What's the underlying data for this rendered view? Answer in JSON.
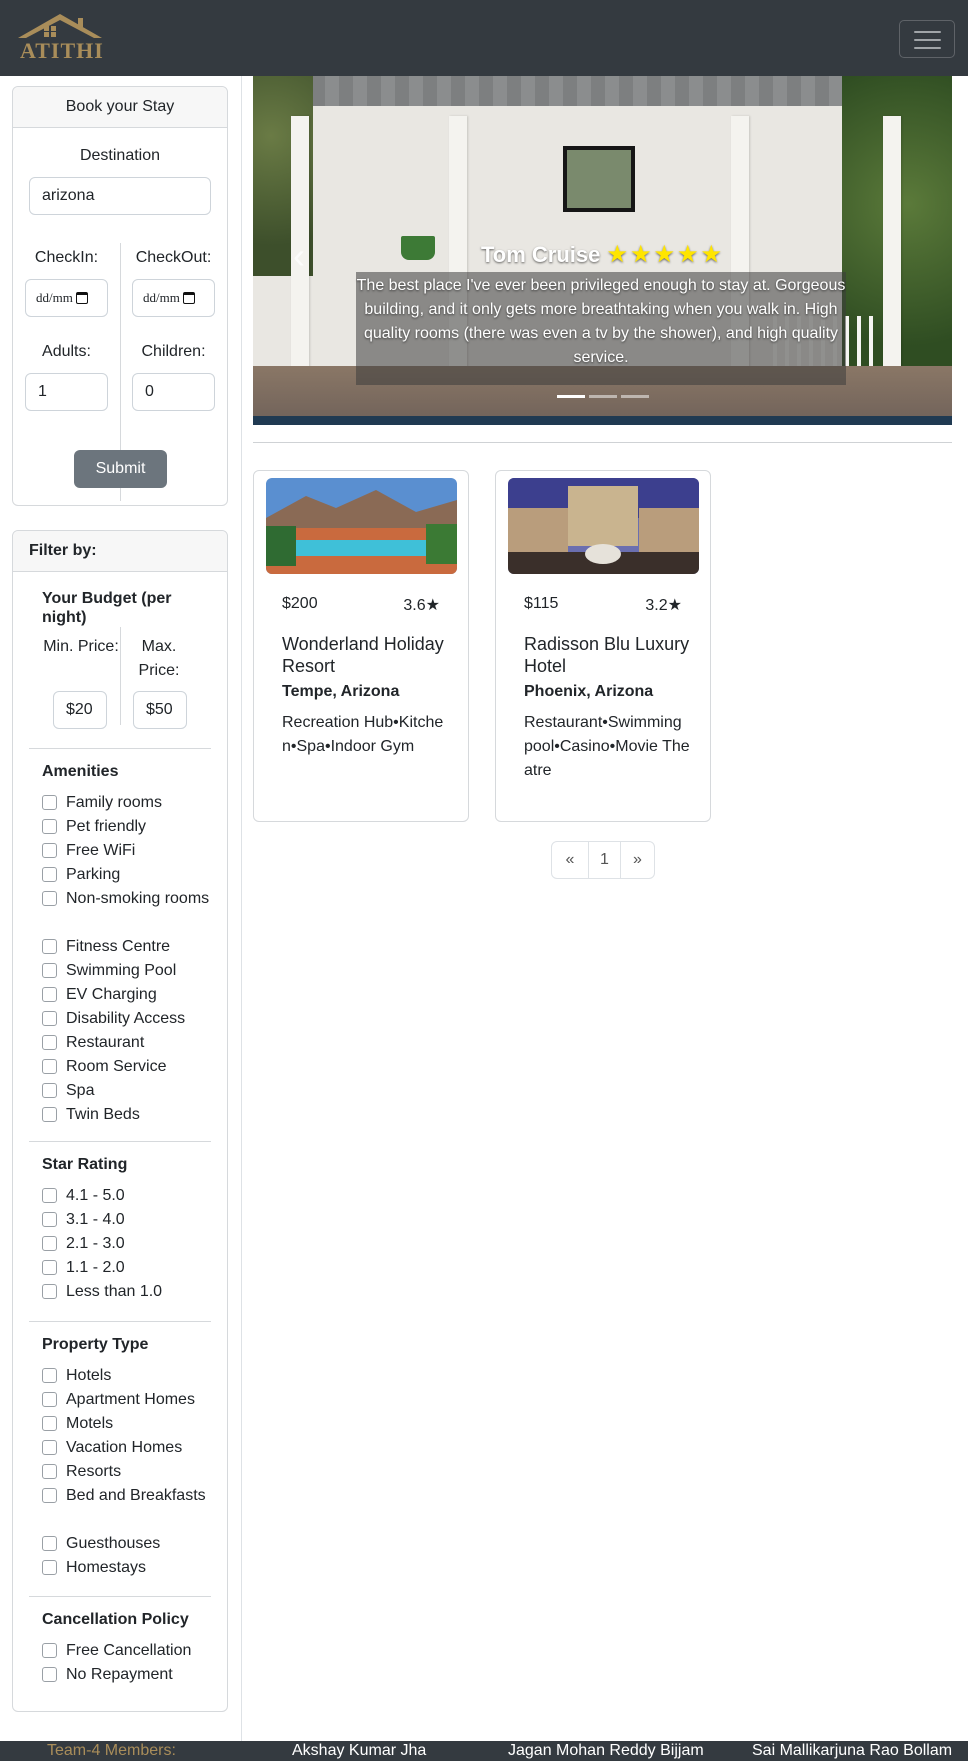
{
  "brand": {
    "name": "ATITHI"
  },
  "booking": {
    "title": "Book your Stay",
    "destination_label": "Destination",
    "destination_value": "arizona",
    "checkin_label": "CheckIn:",
    "checkout_label": "CheckOut:",
    "date_placeholder": "dd/mm",
    "adults_label": "Adults:",
    "adults_value": "1",
    "children_label": "Children:",
    "children_value": "0",
    "submit_label": "Submit"
  },
  "filters": {
    "title": "Filter by:",
    "budget": {
      "title": "Your Budget (per night)",
      "min_label": "Min. Price:",
      "max_label": "Max. Price:",
      "min_value": "$20",
      "max_value": "$50"
    },
    "amenities": {
      "title": "Amenities",
      "items": [
        "Family rooms",
        "Pet friendly",
        "Free WiFi",
        "Parking",
        "Non-smoking rooms",
        "Fitness Centre",
        "Swimming Pool",
        "EV Charging",
        "Disability Access",
        "Restaurant",
        "Room Service",
        "Spa",
        "Twin Beds"
      ]
    },
    "star_rating": {
      "title": "Star Rating",
      "items": [
        "4.1 - 5.0",
        "3.1 - 4.0",
        "2.1 - 3.0",
        "1.1 - 2.0",
        "Less than 1.0"
      ]
    },
    "property_type": {
      "title": "Property Type",
      "items": [
        "Hotels",
        "Apartment Homes",
        "Motels",
        "Vacation Homes",
        "Resorts",
        "Bed and Breakfasts",
        "Guesthouses",
        "Homestays"
      ]
    },
    "cancellation": {
      "title": "Cancellation Policy",
      "items": [
        "Free Cancellation",
        "No Repayment"
      ]
    }
  },
  "hero": {
    "reviewer": "Tom Cruise",
    "stars": "★★★★★",
    "star_count": 5,
    "review": "The best place I've ever been privileged enough to stay at. Gorgeous building, and it only gets more breathtaking when you walk in. High quality rooms (there was even a tv by the shower), and high quality service.",
    "prev_icon": "chevron-left-icon",
    "slides": 3,
    "active_slide": 1
  },
  "hotels": [
    {
      "price": "$200",
      "rating": "3.6",
      "name": "Wonderland Holiday Resort",
      "location": "Tempe, Arizona",
      "amenities": "Recreation Hub•Kitchen•Spa•Indoor Gym"
    },
    {
      "price": "$115",
      "rating": "3.2",
      "name": "Radisson Blu Luxury Hotel",
      "location": "Phoenix, Arizona",
      "amenities": "Restaurant•Swimming pool•Casino•Movie Theatre"
    }
  ],
  "pagination": {
    "prev": "«",
    "page": "1",
    "next": "»"
  },
  "footer": {
    "label": "Team-4 Members:",
    "members": [
      "Akshay Kumar Jha",
      "Jagan Mohan Reddy Bijjam",
      "Sai Mallikarjuna Rao Bollam"
    ]
  },
  "colors": {
    "navbar": "#343a40",
    "brand_gold": "#a98d5a",
    "submit": "#6c757d",
    "star_yellow": "#ffe500"
  }
}
